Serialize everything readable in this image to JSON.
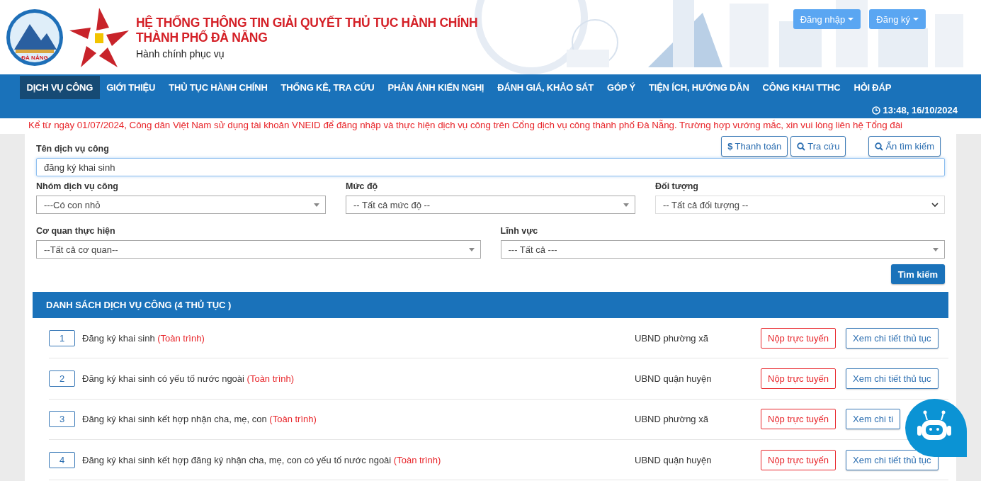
{
  "header": {
    "title_lines": [
      "HỆ THỐNG THÔNG TIN GIẢI QUYẾT THỦ TỤC HÀNH CHÍNH",
      "THÀNH PHỐ ĐÀ NẴNG"
    ],
    "subtitle": "Hành chính phục vụ",
    "emblem_text": "ĐÀ NẴNG",
    "auth_buttons": [
      {
        "label": "Đăng nhập"
      },
      {
        "label": "Đăng ký"
      }
    ]
  },
  "nav": {
    "items": [
      {
        "label": "DỊCH VỤ CÔNG",
        "selected": true
      },
      {
        "label": "GIỚI THIỆU",
        "selected": false
      },
      {
        "label": "THỦ TỤC HÀNH CHÍNH",
        "selected": false
      },
      {
        "label": "THỐNG KÊ, TRA CỨU",
        "selected": false
      },
      {
        "label": "PHẢN ÁNH KIẾN NGHỊ",
        "selected": false
      },
      {
        "label": "ĐÁNH GIÁ, KHẢO SÁT",
        "selected": false
      },
      {
        "label": "GÓP Ý",
        "selected": false
      },
      {
        "label": "TIỆN ÍCH, HƯỚNG DẪN",
        "selected": false
      },
      {
        "label": "CÔNG KHAI TTHC",
        "selected": false
      },
      {
        "label": "HỎI ĐÁP",
        "selected": false
      }
    ],
    "datetime": "13:48, 16/10/2024"
  },
  "notice": "Kể từ ngày 01/07/2024, Công dân Việt Nam sử dụng tài khoản VNEID để đăng nhập và thực hiện dịch vụ công trên Cổng dịch vụ công thành phố Đà Nẵng. Trường hợp vướng mắc, xin vui lòng liên hệ Tổng đài",
  "search": {
    "actions": [
      {
        "label": "Thanh toán",
        "kind": "pay",
        "icon_text": "$"
      },
      {
        "label": "Tra cứu",
        "kind": "search"
      },
      {
        "label": "Ẩn tìm kiếm",
        "kind": "search"
      }
    ],
    "rows": [
      [
        {
          "label": "Tên dịch vụ công",
          "value": "đăng ký khai sinh",
          "kind": "text"
        }
      ],
      [
        {
          "label": "Nhóm dịch vụ công",
          "value": "---Có con nhỏ",
          "kind": "dropdown"
        },
        {
          "label": "Mức độ",
          "value": "-- Tất cả mức độ --",
          "kind": "dropdown"
        },
        {
          "label": "Đối tượng",
          "value": "-- Tất cả đối tượng --",
          "kind": "native"
        }
      ],
      [
        {
          "label": "Cơ quan thực hiện",
          "value": "--Tất cả cơ quan--",
          "kind": "dropdown"
        },
        {
          "label": "Lĩnh vực",
          "value": "--- Tất cả ---",
          "kind": "dropdown"
        }
      ]
    ],
    "submit": "Tìm kiếm"
  },
  "results": {
    "title": "DANH SÁCH DỊCH VỤ CÔNG (4 THỦ TỤC )",
    "rows": [
      {
        "number": "1",
        "name": "Đăng ký khai sinh",
        "scope": "(Toàn trình)",
        "agency": "UBND phường xã",
        "submit": "Nộp trực tuyến",
        "detail": "Xem chi tiết thủ tục"
      },
      {
        "number": "2",
        "name": "Đăng ký khai sinh có yếu tố nước ngoài",
        "scope": "(Toàn trình)",
        "agency": "UBND quận huyện",
        "submit": "Nộp trực tuyến",
        "detail": "Xem chi tiết thủ tục"
      },
      {
        "number": "3",
        "name": "Đăng ký khai sinh kết hợp nhận cha, mẹ, con",
        "scope": "(Toàn trình)",
        "agency": "UBND phường xã",
        "submit": "Nộp trực tuyến",
        "detail": "Xem chi ti"
      },
      {
        "number": "4",
        "name": "Đăng ký khai sinh kết hợp đăng ký nhận cha, mẹ, con có yếu tố nước ngoài",
        "scope": "(Toàn trình)",
        "agency": "UBND quận huyện",
        "submit": "Nộp trực tuyến",
        "detail": "Xem chi tiết thủ tục"
      }
    ]
  }
}
